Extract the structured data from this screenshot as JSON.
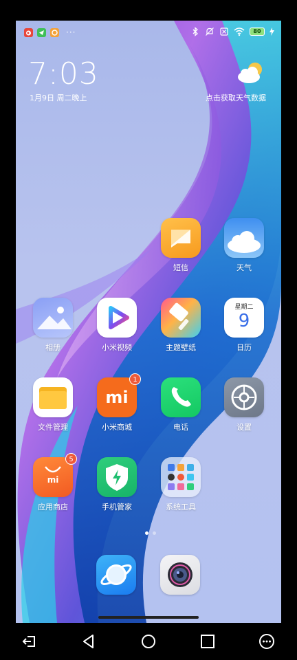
{
  "status_bar": {
    "left_app_icons": [
      "weibo-icon",
      "message-arrow-icon",
      "browser-icon"
    ],
    "more_dots": "···",
    "right_icons": [
      "bluetooth-icon",
      "mute-icon",
      "sim-off-icon",
      "wifi-icon"
    ],
    "battery_level": "80",
    "charging": true
  },
  "clock": {
    "time": "7:03",
    "date": "1月9日 周二晚上"
  },
  "weather": {
    "prompt": "点击获取天气数据"
  },
  "apps": [
    {
      "id": "sms",
      "label": "短信",
      "icon": "message-icon"
    },
    {
      "id": "weather",
      "label": "天气",
      "icon": "cloud-icon"
    },
    {
      "id": "gallery",
      "label": "相册",
      "icon": "gallery-icon"
    },
    {
      "id": "mivideo",
      "label": "小米视频",
      "icon": "play-icon"
    },
    {
      "id": "themes",
      "label": "主题壁纸",
      "icon": "brush-icon"
    },
    {
      "id": "calendar",
      "label": "日历",
      "icon": "calendar-icon",
      "weekday": "星期二",
      "day": "9"
    },
    {
      "id": "files",
      "label": "文件管理",
      "icon": "folder-icon"
    },
    {
      "id": "mistore",
      "label": "小米商城",
      "icon": "mi-logo-icon",
      "badge": "1",
      "logo_text": "mi"
    },
    {
      "id": "phone",
      "label": "电话",
      "icon": "phone-icon"
    },
    {
      "id": "settings",
      "label": "设置",
      "icon": "gear-icon"
    },
    {
      "id": "appstore",
      "label": "应用商店",
      "icon": "shopping-bag-icon",
      "badge": "5",
      "logo_text": "mi"
    },
    {
      "id": "security",
      "label": "手机管家",
      "icon": "shield-icon"
    },
    {
      "id": "tools",
      "label": "系统工具",
      "icon": "folder-grid-icon"
    }
  ],
  "pager": {
    "pages": 2,
    "current": 1
  },
  "dock": [
    {
      "id": "browser",
      "icon": "browser-planet-icon"
    },
    {
      "id": "camera",
      "icon": "camera-icon"
    }
  ],
  "navbar": {
    "buttons": [
      "exit-icon",
      "back-icon",
      "home-icon",
      "recents-icon",
      "more-icon"
    ]
  }
}
